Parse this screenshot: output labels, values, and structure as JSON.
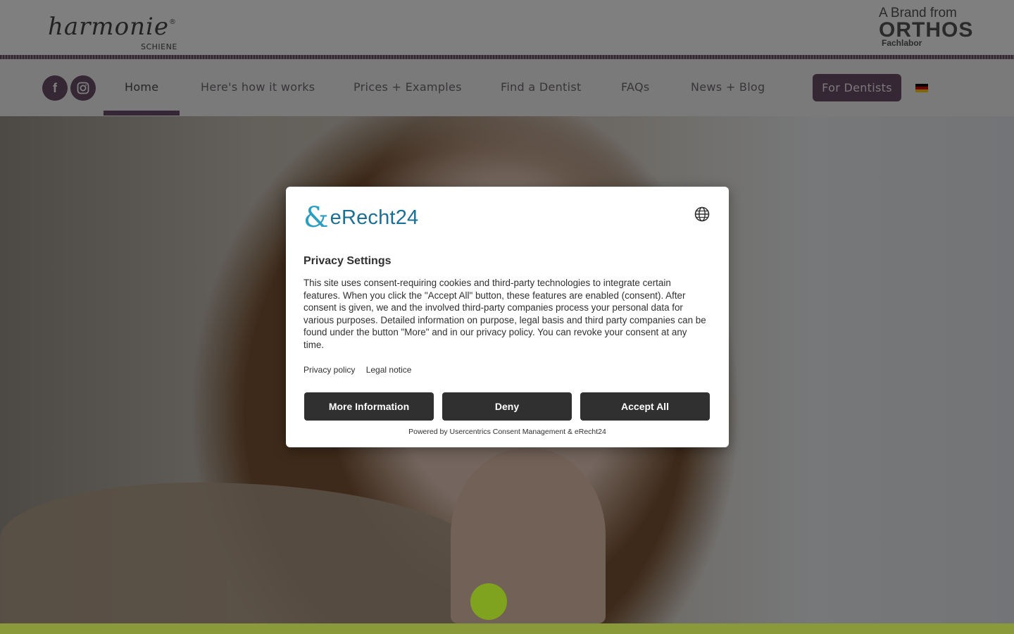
{
  "header": {
    "logo_text": "harmonie",
    "logo_registered": "®",
    "logo_subtitle": "SCHIENE",
    "brand_prefix": "A Brand from",
    "brand_name": "ORTHOS",
    "brand_sub": "Fachlabor"
  },
  "nav": {
    "social": [
      {
        "name": "facebook-icon",
        "glyph": "f"
      },
      {
        "name": "instagram-icon",
        "glyph": "◎"
      }
    ],
    "items": [
      {
        "label": "Home",
        "active": true
      },
      {
        "label": "Here's how it works"
      },
      {
        "label": "Prices + Examples"
      },
      {
        "label": "Find a Dentist"
      },
      {
        "label": "FAQs"
      },
      {
        "label": "News + Blog"
      }
    ],
    "cta_label": "For Dentists",
    "language_flag": "german-flag-icon"
  },
  "consent": {
    "logo_text": "eRecht24",
    "title": "Privacy Settings",
    "body": "This site uses consent-requiring cookies and third-party technologies to integrate certain features. When you click the \"Accept All\" button, these features are enabled (consent). After consent is given, we and the involved third-party companies process your personal data for various purposes. Detailed information on purpose, legal basis and third party companies can be found under the button \"More\" and in our privacy policy. You can revoke your consent at any time.",
    "links": [
      "Privacy policy",
      "Legal notice"
    ],
    "buttons": {
      "more": "More Information",
      "deny": "Deny",
      "accept": "Accept All"
    },
    "footer": "Powered by Usercentrics Consent Management & eRecht24"
  },
  "colors": {
    "brand_purple": "#6b4f68",
    "modal_button": "#303030",
    "accent_green": "#7fa31e"
  }
}
